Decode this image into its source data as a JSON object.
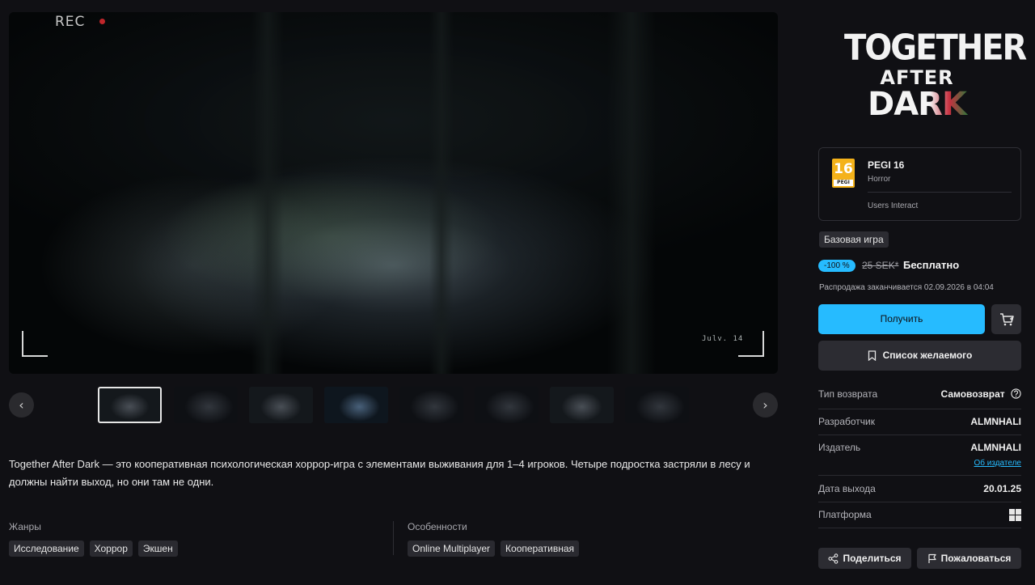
{
  "media": {
    "rec_label": "REC",
    "timestamp": "Julv. 14"
  },
  "gallery": {
    "prev_icon": "chevron-left-icon",
    "next_icon": "chevron-right-icon",
    "prev_glyph": "‹",
    "next_glyph": "›",
    "thumbnail_count": 8
  },
  "description": "Together After Dark — это кооперативная психологическая хоррор-игра с элементами выживания для 1–4 игроков. Четыре подростка застряли в лесу и должны найти выход, но они там не одни.",
  "genres": {
    "label": "Жанры",
    "tags": [
      "Исследование",
      "Хоррор",
      "Экшен"
    ]
  },
  "features": {
    "label": "Особенности",
    "tags": [
      "Online Multiplayer",
      "Кооперативная"
    ]
  },
  "logo": {
    "line1": "TOGETHER",
    "line2": "AFTER",
    "line3": "DARK"
  },
  "rating": {
    "badge_number": "16",
    "badge_sub": "PEGI",
    "title": "PEGI 16",
    "genre": "Horror",
    "extra": "Users Interact"
  },
  "purchase": {
    "base_badge": "Базовая игра",
    "discount": "-100 %",
    "old_price": "25 SEK*",
    "new_price": "Бесплатно",
    "sale_end": "Распродажа заканчивается 02.09.2026 в 04:04",
    "get_label": "Получить",
    "wishlist_label": "Список желаемого"
  },
  "details": {
    "refund_label": "Тип возврата",
    "refund_value": "Самовозврат",
    "developer_label": "Разработчик",
    "developer_value": "ALMNHALI",
    "publisher_label": "Издатель",
    "publisher_value": "ALMNHALI",
    "publisher_link": "Об издателе",
    "release_label": "Дата выхода",
    "release_value": "20.01.25",
    "platform_label": "Платформа",
    "platform_icon": "windows-icon"
  },
  "actions": {
    "share_label": "Поделиться",
    "report_label": "Пожаловаться"
  },
  "colors": {
    "background": "#101014",
    "accent": "#26bbff",
    "pegi_orange": "#f4b21a"
  }
}
